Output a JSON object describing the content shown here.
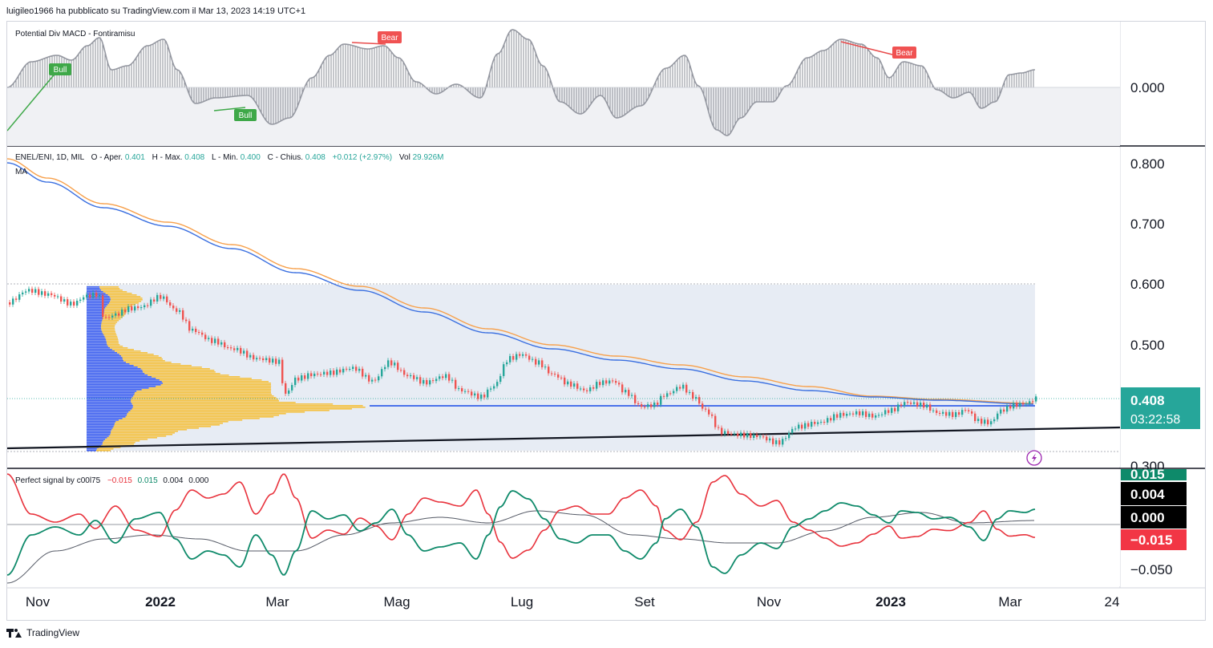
{
  "header": {
    "publish_line": "luigileo1966 ha pubblicato su TradingView.com il Mar 13, 2023 14:19 UTC+1"
  },
  "brand": {
    "name": "TradingView"
  },
  "colors": {
    "bull": "#26a69a",
    "bear": "#ef5350",
    "ma_blue": "#3a6fe0",
    "ma_orange": "#f7a04b",
    "vp_blue": "#4062f0",
    "vp_yellow": "#f5c242",
    "osc_green": "#0e8a6a",
    "osc_red": "#e8323c",
    "macd_hist": "#9598a1",
    "price_tag": "#26a69a"
  },
  "macd_pane": {
    "title": "Potential Div MACD - Fontiramisu",
    "axis_label": "0.000",
    "labels": [
      {
        "text": "Bull",
        "kind": "bull"
      },
      {
        "text": "Bull",
        "kind": "bull"
      },
      {
        "text": "Bear",
        "kind": "bear"
      },
      {
        "text": "Bear",
        "kind": "bear"
      }
    ]
  },
  "main_pane": {
    "legend": {
      "symbol": "ENEL/ENI, 1D, MIL",
      "o_label": "O - Aper.",
      "o_value": "0.401",
      "h_label": "H - Max.",
      "h_value": "0.408",
      "l_label": "L - Min.",
      "l_value": "0.400",
      "c_label": "C - Chius.",
      "c_value": "0.408",
      "change": "+0.012 (+2.97%)",
      "vol_label": "Vol",
      "vol_value": "29.926M"
    },
    "ma_label": "MA",
    "price_axis": [
      "0.800",
      "0.700",
      "0.600",
      "0.500",
      "0.300"
    ],
    "last_price": "0.408",
    "countdown": "03:22:58"
  },
  "osc_pane": {
    "legend": {
      "name": "Perfect signal by c00l75",
      "v1": "−0.015",
      "v2": "0.015",
      "v3": "0.004",
      "v4": "0.000"
    },
    "axis_labels": [
      "0.015",
      "0.004",
      "0.000",
      "−0.015",
      "−0.050"
    ]
  },
  "time_axis": [
    "Nov",
    "2022",
    "Mar",
    "Mag",
    "Lug",
    "Set",
    "Nov",
    "2023",
    "Mar",
    "24"
  ],
  "chart_data": {
    "type": "line",
    "title": "ENEL/ENI, 1D, MIL",
    "x": [
      "Nov",
      "2022",
      "Mar",
      "Mag",
      "Lug",
      "Set",
      "Nov",
      "2023",
      "Mar",
      "24"
    ],
    "ylim": [
      0.3,
      0.8
    ],
    "series": [
      {
        "name": "ENEL/ENI",
        "values": [
          0.57,
          0.57,
          0.47,
          0.46,
          0.48,
          0.39,
          0.34,
          0.39,
          0.37,
          0.408
        ]
      },
      {
        "name": "MA",
        "values": [
          0.79,
          0.72,
          0.64,
          0.57,
          0.51,
          0.48,
          0.45,
          0.42,
          0.407,
          0.405
        ]
      }
    ],
    "horizontal_levels": [
      0.6,
      0.395,
      0.408
    ],
    "grid": false
  }
}
